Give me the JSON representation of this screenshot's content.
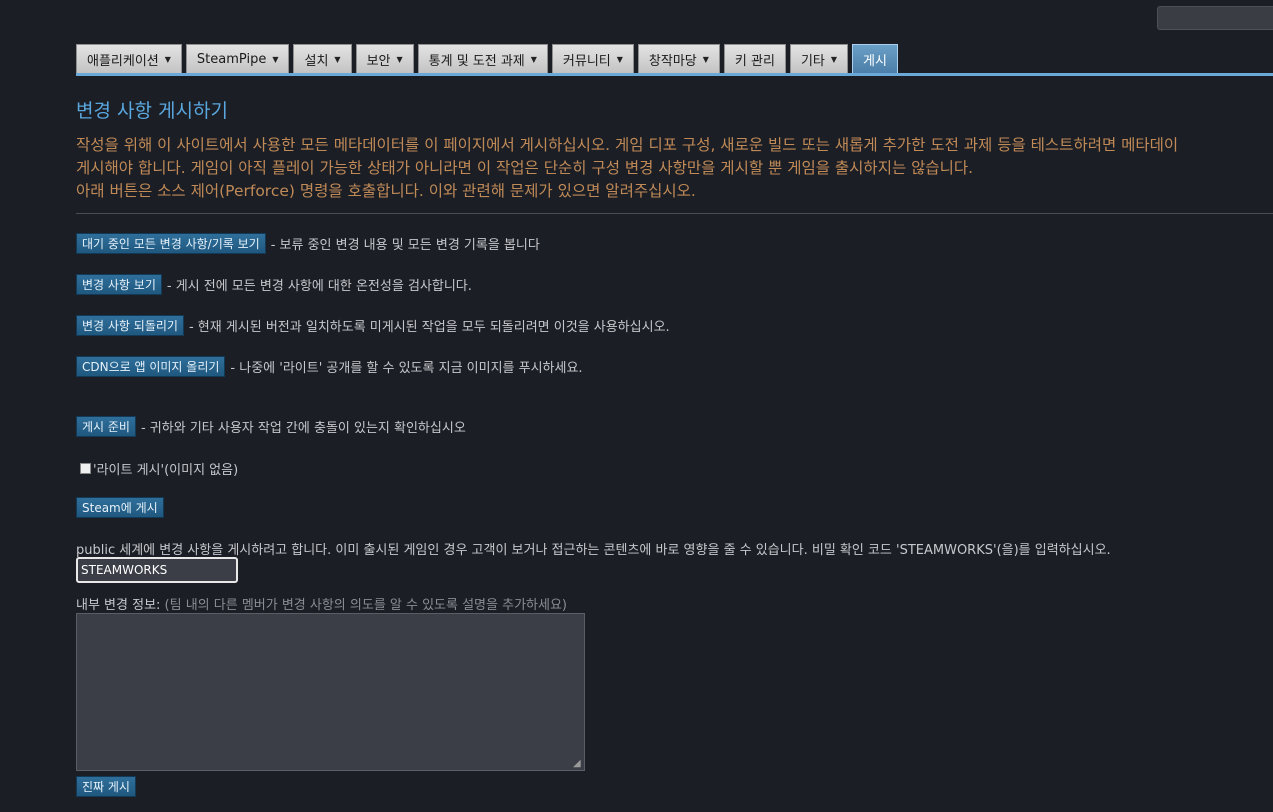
{
  "header": {
    "search_icon": "search-box"
  },
  "tabs": [
    {
      "label": "애플리케이션",
      "dropdown": true,
      "active": false
    },
    {
      "label": "SteamPipe",
      "dropdown": true,
      "active": false
    },
    {
      "label": "설치",
      "dropdown": true,
      "active": false
    },
    {
      "label": "보안",
      "dropdown": true,
      "active": false
    },
    {
      "label": "통계 및 도전 과제",
      "dropdown": true,
      "active": false
    },
    {
      "label": "커뮤니티",
      "dropdown": true,
      "active": false
    },
    {
      "label": "창작마당",
      "dropdown": true,
      "active": false
    },
    {
      "label": "키 관리",
      "dropdown": false,
      "active": false
    },
    {
      "label": "기타",
      "dropdown": true,
      "active": false
    },
    {
      "label": "게시",
      "dropdown": false,
      "active": true
    }
  ],
  "page": {
    "title": "변경 사항 게시하기",
    "intro_line1": "작성을 위해 이 사이트에서 사용한 모든 메타데이터를 이 페이지에서 게시하십시오. 게임 디포 구성, 새로운 빌드 또는 새롭게 추가한 도전 과제 등을 테스트하려면 메타데이",
    "intro_line2": "게시해야 합니다. 게임이 아직 플레이 가능한 상태가 아니라면 이 작업은 단순히 구성 변경 사항만을 게시할 뿐 게임을 출시하지는 않습니다.",
    "intro_line3": "아래 버튼은 소스 제어(Perforce) 명령을 호출합니다. 이와 관련해 문제가 있으면 알려주십시오."
  },
  "actions": {
    "view_pending": {
      "label": "대기 중인 모든 변경 사항/기록 보기",
      "desc": "- 보류 중인 변경 내용 및 모든 변경 기록을 봅니다"
    },
    "view_diff": {
      "label": "변경 사항 보기",
      "desc": "- 게시 전에 모든 변경 사항에 대한 온전성을 검사합니다."
    },
    "revert": {
      "label": "변경 사항 되돌리기",
      "desc": "- 현재 게시된 버전과 일치하도록 미게시된 작업을 모두 되돌리려면 이것을 사용하십시오."
    },
    "cdn": {
      "label": "CDN으로 앱 이미지 올리기",
      "desc": "- 나중에 '라이트' 공개를 할 수 있도록 지금 이미지를 푸시하세요."
    },
    "prepare": {
      "label": "게시 준비",
      "desc": "- 귀하와 기타 사용자 작업 간에 충돌이 있는지 확인하십시오"
    },
    "lite_publish": {
      "label": "'라이트 게시'(이미지 없음)",
      "checked": false
    },
    "publish_steam": {
      "label": "Steam에 게시"
    }
  },
  "confirm": {
    "warning": "public 세계에 변경 사항을 게시하려고 합니다. 이미 출시된 게임인 경우 고객이 보거나 접근하는 콘텐츠에 바로 영향을 줄 수 있습니다. 비밀 확인 코드 'STEAMWORKS'(을)를 입력하십시오.",
    "code_value": "STEAMWORKS",
    "notes_label": "내부 변경 정보:",
    "notes_hint": "(팀 내의 다른 멤버가 변경 사항의 의도를 알 수 있도록 설명을 추가하세요)",
    "notes_value": "",
    "final_button": "진짜 게시"
  },
  "colors": {
    "background": "#1b1e25",
    "title": "#5aa7de",
    "intro_text": "#c08a57",
    "button": "#2f6f9b",
    "active_tab": "#5a8fb8"
  }
}
